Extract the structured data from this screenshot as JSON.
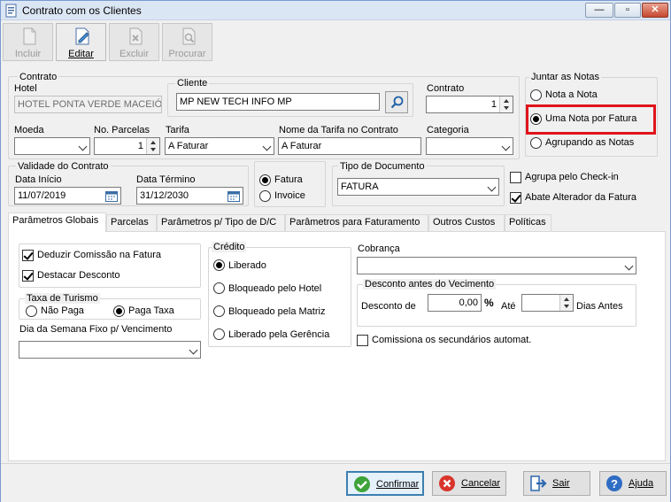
{
  "window": {
    "title": "Contrato com os Clientes",
    "minimize": "—",
    "maximize": "▫",
    "close": "✕"
  },
  "toolbar": {
    "incluir": "Incluir",
    "editar": "Editar",
    "excluir": "Excluir",
    "procurar": "Procurar"
  },
  "contrato": {
    "group_title": "Contrato",
    "hotel_label": "Hotel",
    "hotel_value": "HOTEL PONTA VERDE MACEIÓ",
    "cliente_title": "Cliente",
    "cliente_value": "MP NEW TECH INFO MP",
    "contrato_label": "Contrato",
    "contrato_value": "1",
    "moeda_label": "Moeda",
    "moeda_value": "",
    "parcelas_label": "No. Parcelas",
    "parcelas_value": "1",
    "tarifa_label": "Tarifa",
    "tarifa_value": "A Faturar",
    "nome_tarifa_label": "Nome da Tarifa no Contrato",
    "nome_tarifa_value": "A Faturar",
    "categoria_label": "Categoria",
    "categoria_value": ""
  },
  "juntar": {
    "title": "Juntar as Notas",
    "options": [
      "Nota a Nota",
      "Uma Nota por Fatura",
      "Agrupando as Notas"
    ],
    "selected": "Uma Nota por Fatura"
  },
  "validade": {
    "title": "Validade do Contrato",
    "inicio_label": "Data Início",
    "inicio_value": "11/07/2019",
    "termino_label": "Data Término",
    "termino_value": "31/12/2030"
  },
  "fatura_invoice": {
    "options": [
      "Fatura",
      "Invoice"
    ],
    "selected": "Fatura"
  },
  "tipo_documento": {
    "title": "Tipo de Documento",
    "value": "FATURA"
  },
  "checks_right": {
    "agrupa": "Agrupa pelo Check-in",
    "abate": "Abate Alterador da Fatura"
  },
  "tabs": [
    "Parâmetros Globais",
    "Parcelas",
    "Parâmetros p/ Tipo de D/C",
    "Parâmetros para Faturamento",
    "Outros Custos",
    "Políticas"
  ],
  "globais": {
    "deduzir": "Deduzir Comissão na Fatura",
    "destacar": "Destacar Desconto",
    "taxa_title": "Taxa de Turismo",
    "nao_paga": "Não Paga",
    "paga_taxa": "Paga Taxa",
    "dia_semana_label": "Dia da Semana Fixo p/ Vencimento",
    "dia_semana_value": ""
  },
  "credito": {
    "title": "Crédito",
    "options": [
      "Liberado",
      "Bloqueado pelo Hotel",
      "Bloqueado pela Matriz",
      "Liberado pela Gerência"
    ],
    "selected": "Liberado"
  },
  "cobranca": {
    "label": "Cobrança",
    "value": "",
    "desconto_title": "Desconto antes do Vecimento",
    "desconto_label": "Desconto de",
    "desconto_value": "0,00",
    "percent": "%",
    "ate": "Até",
    "dias_value": "",
    "dias_antes": "Dias Antes",
    "comissiona": "Comissiona os secundários automat."
  },
  "buttons": {
    "confirmar": "Confirmar",
    "cancelar": "Cancelar",
    "sair": "Sair",
    "ajuda": "Ajuda"
  },
  "colors": {
    "highlight": "#e0141a",
    "focus_border": "#3c7fb1"
  }
}
